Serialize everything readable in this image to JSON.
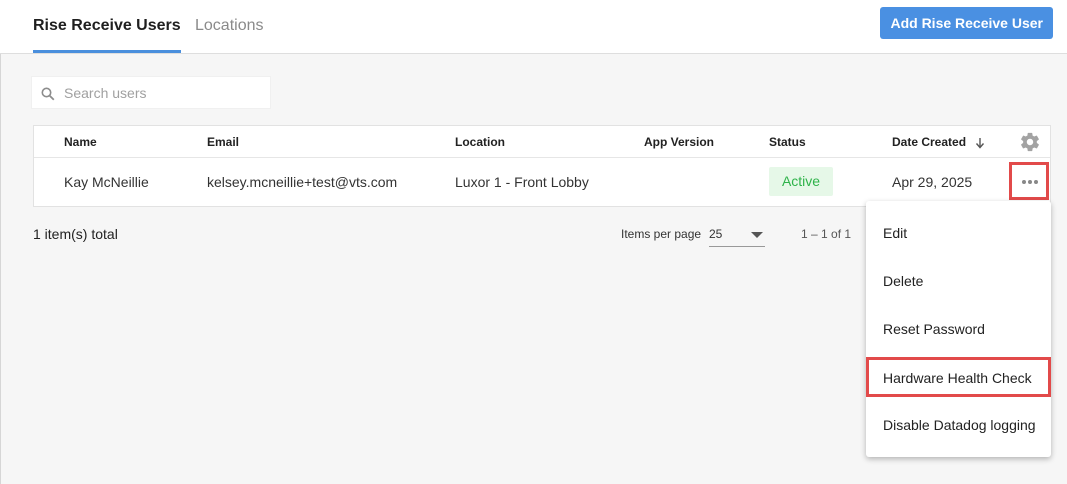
{
  "tabs": [
    {
      "label": "Rise Receive Users",
      "active": true
    },
    {
      "label": "Locations",
      "active": false
    }
  ],
  "header": {
    "add_button": "Add Rise Receive User"
  },
  "search": {
    "placeholder": "Search users",
    "value": "",
    "icon": "search-icon"
  },
  "table": {
    "columns": [
      "Name",
      "Email",
      "Location",
      "App Version",
      "Status",
      "Date Created"
    ],
    "sort_column": "Date Created",
    "sort_direction": "descending",
    "settings_icon": "gear-icon",
    "rows": [
      {
        "name": "Kay McNeillie",
        "email": "kelsey.mcneillie+test@vts.com",
        "location": "Luxor 1 - Front Lobby",
        "app_version": "",
        "status": "Active",
        "date_created": "Apr 29, 2025"
      }
    ]
  },
  "footer": {
    "total": "1 item(s) total",
    "per_page_label": "Items per page",
    "per_page_value": "25",
    "range": "1 – 1 of 1"
  },
  "menu": {
    "items": [
      "Edit",
      "Delete",
      "Reset Password",
      "Hardware Health Check",
      "Disable Datadog logging"
    ],
    "highlighted": "Hardware Health Check"
  },
  "colors": {
    "accent": "#4a90e2",
    "highlight_border": "#e24a4a",
    "status_active_bg": "#e6f8e8",
    "status_active_text": "#2fb34a"
  }
}
